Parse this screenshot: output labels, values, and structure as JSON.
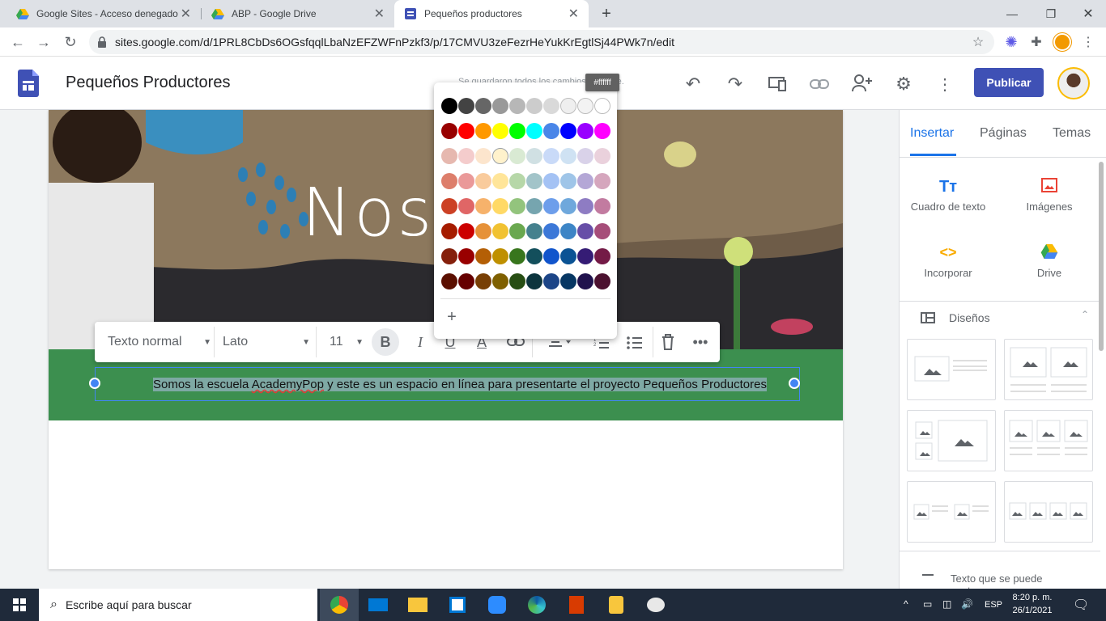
{
  "browser": {
    "tabs": [
      {
        "title": "Google Sites - Acceso denegado"
      },
      {
        "title": "ABP - Google Drive"
      },
      {
        "title": "Pequeños productores"
      }
    ],
    "url": "sites.google.com/d/1PRL8CbDs6OGsfqqlLbaNzEFZWFnPzkf3/p/17CMVU3zeFezrHeYukKrEgtlSj44PWk7n/edit"
  },
  "site": {
    "title": "Pequeños Productores",
    "save_status": "Se guardaron todos los cambios en Drive.",
    "publish_label": "Publicar"
  },
  "page": {
    "hero_title": "Noso",
    "body_text_parts": [
      "Somos la escuela ",
      "AcademyPop",
      " y este es un espacio en línea para presentarte el proyecto Pequeños Productores"
    ]
  },
  "format_toolbar": {
    "style": "Texto normal",
    "font": "Lato",
    "size": "11"
  },
  "color_palette": {
    "tooltip": "#ffffff",
    "selected": "#fff2cc",
    "rows": [
      [
        "#000000",
        "#434343",
        "#666666",
        "#999999",
        "#b7b7b7",
        "#cccccc",
        "#d9d9d9",
        "#efefef",
        "#f3f3f3",
        "#ffffff"
      ],
      [
        "#980000",
        "#ff0000",
        "#ff9900",
        "#ffff00",
        "#00ff00",
        "#00ffff",
        "#4a86e8",
        "#0000ff",
        "#9900ff",
        "#ff00ff"
      ],
      [
        "#e6b8af",
        "#f4cccc",
        "#fce5cd",
        "#fff2cc",
        "#d9ead3",
        "#d0e0e3",
        "#c9daf8",
        "#cfe2f3",
        "#d9d2e9",
        "#ead1dc"
      ],
      [
        "#dd7e6b",
        "#ea9999",
        "#f9cb9c",
        "#ffe599",
        "#b6d7a8",
        "#a2c4c9",
        "#a4c2f4",
        "#9fc5e8",
        "#b4a7d6",
        "#d5a6bd"
      ],
      [
        "#cc4125",
        "#e06666",
        "#f6b26b",
        "#ffd966",
        "#93c47d",
        "#76a5af",
        "#6d9eeb",
        "#6fa8dc",
        "#8e7cc3",
        "#c27ba0"
      ],
      [
        "#a61c00",
        "#cc0000",
        "#e69138",
        "#f1c232",
        "#6aa84f",
        "#45818e",
        "#3c78d8",
        "#3d85c6",
        "#674ea7",
        "#a64d79"
      ],
      [
        "#85200c",
        "#990000",
        "#b45f06",
        "#bf9000",
        "#38761d",
        "#134f5c",
        "#1155cc",
        "#0b5394",
        "#351c75",
        "#741b47"
      ],
      [
        "#5b0f00",
        "#660000",
        "#783f04",
        "#7f6000",
        "#274e13",
        "#0c343d",
        "#1c4587",
        "#073763",
        "#20124d",
        "#4c1130"
      ]
    ]
  },
  "panel": {
    "tabs": [
      "Insertar",
      "Páginas",
      "Temas"
    ],
    "insert_items": [
      "Cuadro de texto",
      "Imágenes",
      "Incorporar",
      "Drive"
    ],
    "layouts_label": "Diseños",
    "bottom_item": "Texto que se puede contraer"
  },
  "taskbar": {
    "search_placeholder": "Escribe aquí para buscar",
    "lang": "ESP",
    "time": "8:20 p. m.",
    "date": "26/1/2021"
  }
}
